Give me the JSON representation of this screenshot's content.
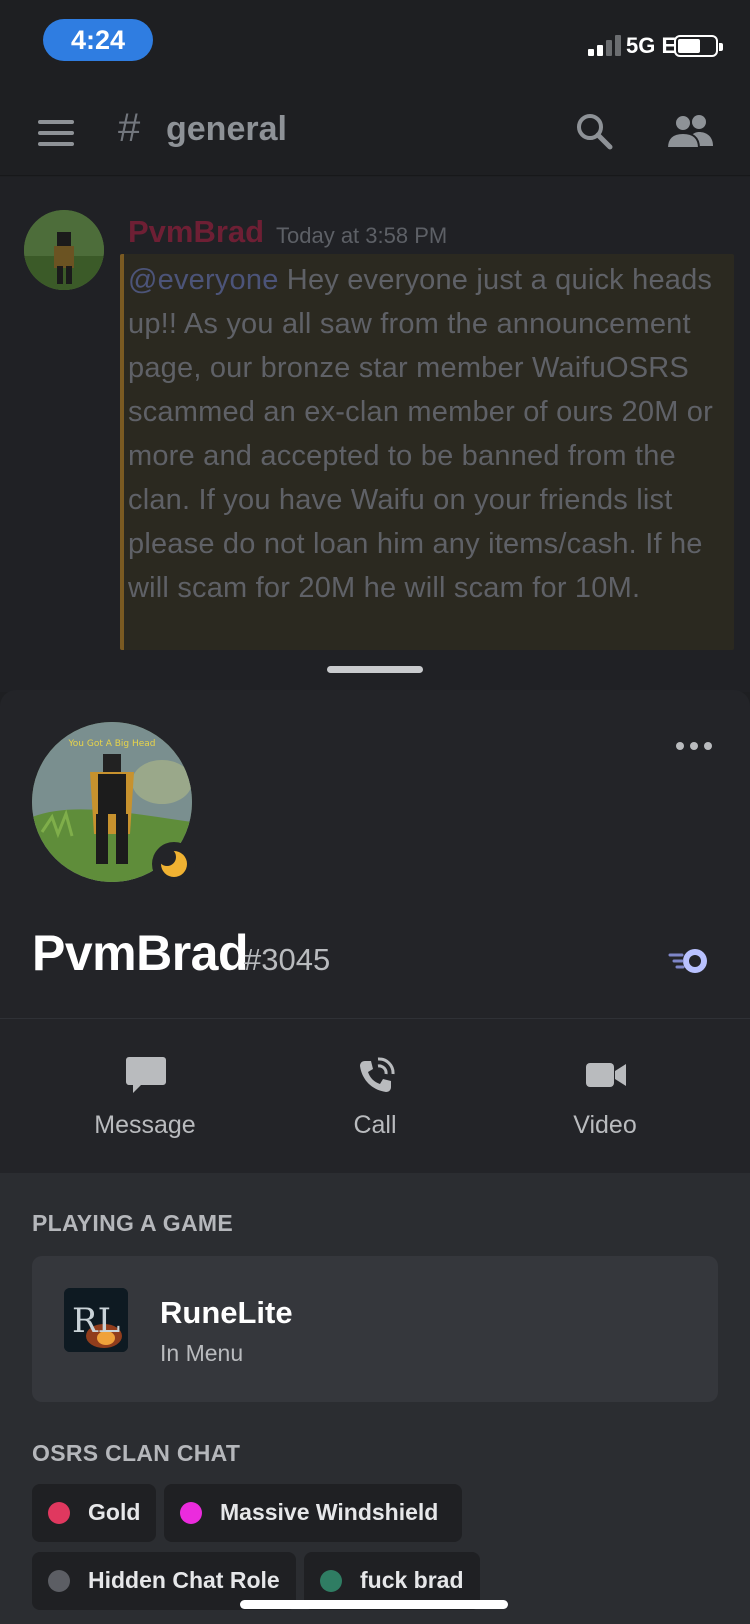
{
  "status_bar": {
    "time": "4:24",
    "network": "5G E"
  },
  "channel": {
    "hash": "#",
    "name": "general"
  },
  "message": {
    "author": "PvmBrad",
    "timestamp": "Today at 3:58 PM",
    "mention": "@everyone",
    "body": " Hey everyone just a quick heads up!! As you all saw from the announcement page, our bronze star member WaifuOSRS scammed an ex-clan member of ours 20M or more and accepted to be banned from the clan. If you have Waifu on your friends list please do not loan him any items/cash. If he will scam for 20M he will scam for 10M."
  },
  "profile": {
    "avatar_caption": "You Got A Big Head",
    "username": "PvmBrad",
    "discriminator": "#3045",
    "status": "idle-moon",
    "status_color": "#f0b232"
  },
  "actions": [
    {
      "label": "Message",
      "icon": "chat-bubble-icon"
    },
    {
      "label": "Call",
      "icon": "phone-icon"
    },
    {
      "label": "Video",
      "icon": "video-camera-icon"
    }
  ],
  "activity": {
    "section_title": "PLAYING A GAME",
    "game_name": "RuneLite",
    "game_state": "In Menu",
    "game_icon_text": "RL"
  },
  "roles": {
    "section_title": "OSRS CLAN CHAT",
    "items": [
      {
        "label": "Gold",
        "color": "#e0385f"
      },
      {
        "label": "Massive Windshield",
        "color": "#eb2bdd"
      },
      {
        "label": "Hidden Chat Role",
        "color": "#5c5e64"
      },
      {
        "label": "fuck brad",
        "color": "#2f7d63"
      }
    ]
  }
}
